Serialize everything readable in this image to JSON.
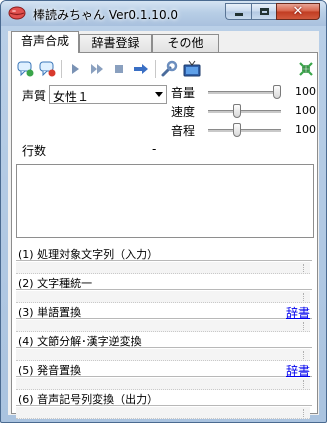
{
  "window": {
    "title": "棒読みちゃん Ver0.1.10.0"
  },
  "tabs": [
    {
      "label": "音声合成",
      "active": true
    },
    {
      "label": "辞書登録",
      "active": false
    },
    {
      "label": "その他",
      "active": false
    }
  ],
  "toolbar": {
    "icons": [
      "speak-text-icon",
      "stop-speech-icon",
      "play-icon",
      "fast-forward-icon",
      "stop-icon",
      "next-icon",
      "settings-wrench-icon",
      "tv-icon",
      "collapse-icon"
    ]
  },
  "voice": {
    "label": "声質",
    "selected": "女性１"
  },
  "sliders": [
    {
      "label": "音量",
      "value": "100",
      "level": 1.0
    },
    {
      "label": "速度",
      "value": "100",
      "level": 0.38
    },
    {
      "label": "音程",
      "value": "100",
      "level": 0.38
    }
  ],
  "line_count": {
    "label": "行数",
    "value": "-"
  },
  "stages": [
    {
      "title": "(1) 処理対象文字列（入力）",
      "dict_link": ""
    },
    {
      "title": "(2) 文字種統一",
      "dict_link": ""
    },
    {
      "title": "(3) 単語置換",
      "dict_link": "辞書"
    },
    {
      "title": "(4) 文節分解･漢字逆変換",
      "dict_link": ""
    },
    {
      "title": "(5) 発音置換",
      "dict_link": "辞書"
    },
    {
      "title": "(6) 音声記号列変換（出力）",
      "dict_link": ""
    }
  ],
  "colors": {
    "link": "#0000ee",
    "close_button": "#c13c22",
    "titlebar": "#b8cee6"
  }
}
